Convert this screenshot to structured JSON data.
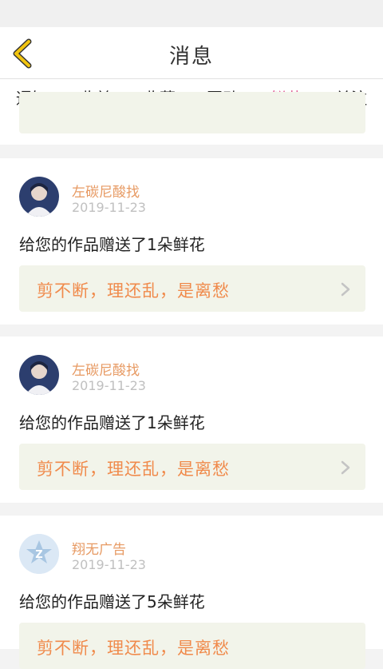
{
  "header": {
    "title": "消息"
  },
  "tabs": [
    {
      "label": "通知"
    },
    {
      "label": "收益"
    },
    {
      "label": "收藏"
    },
    {
      "label": "互动"
    },
    {
      "label": "鲜花",
      "active": true
    },
    {
      "label": "关注"
    }
  ],
  "messages": [
    {
      "user": "左碳尼酸找",
      "date": "2019-11-23",
      "text": "给您的作品赠送了1朵鲜花",
      "quote": "剪不断，理还乱，是离愁",
      "avatar": "avatar-photo"
    },
    {
      "user": "左碳尼酸找",
      "date": "2019-11-23",
      "text": "给您的作品赠送了1朵鲜花",
      "quote": "剪不断，理还乱，是离愁",
      "avatar": "avatar-photo"
    },
    {
      "user": "翔无广告",
      "date": "2019-11-23",
      "text": "给您的作品赠送了5朵鲜花",
      "quote": "剪不断，理还乱，是离愁",
      "avatar": "z-logo-avatar"
    }
  ],
  "colors": {
    "accent": "#e05b92",
    "username": "#e79a63",
    "quote_text": "#f08a4b",
    "quote_bg": "#f2f4ea",
    "back_arrow": "#f1c40f"
  }
}
